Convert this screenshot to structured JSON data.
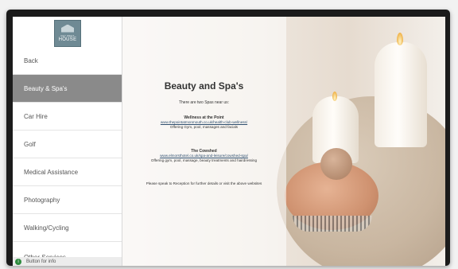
{
  "logo": {
    "line1": "KEY WEST",
    "line2": "HOUSE"
  },
  "sidebar": {
    "items": [
      {
        "label": "Back"
      },
      {
        "label": "Beauty & Spa's",
        "active": true
      },
      {
        "label": "Car Hire"
      },
      {
        "label": "Golf"
      },
      {
        "label": "Medical Assistance"
      },
      {
        "label": "Photography"
      },
      {
        "label": "Walking/Cycling"
      },
      {
        "label": "Other Services"
      }
    ]
  },
  "footer": {
    "info_badge": "i",
    "label": "Button for info"
  },
  "content": {
    "title": "Beauty and Spa's",
    "intro": "There are two Spas near us:",
    "spas": [
      {
        "name": "Wellness at the Point",
        "url": "www.thepointatmonmouth.co.uk/health-club-wellness/",
        "desc": "Offering Gym, pool, massages and facials"
      },
      {
        "name": "The Cowshed",
        "url": "www.elmorsthotel.co.uk/spa-and-leisure/cowshed-spa/",
        "desc": "Offering gym, pool, massage, beauty treatments and hairdressing"
      }
    ],
    "note": "Please speak to Reception for further details or visit the above websites"
  },
  "colors": {
    "active_item_bg": "#8a8a8a",
    "logo_bg": "#6f8a94",
    "info_green": "#2e8b3e",
    "link_color": "#2f4f6f"
  }
}
